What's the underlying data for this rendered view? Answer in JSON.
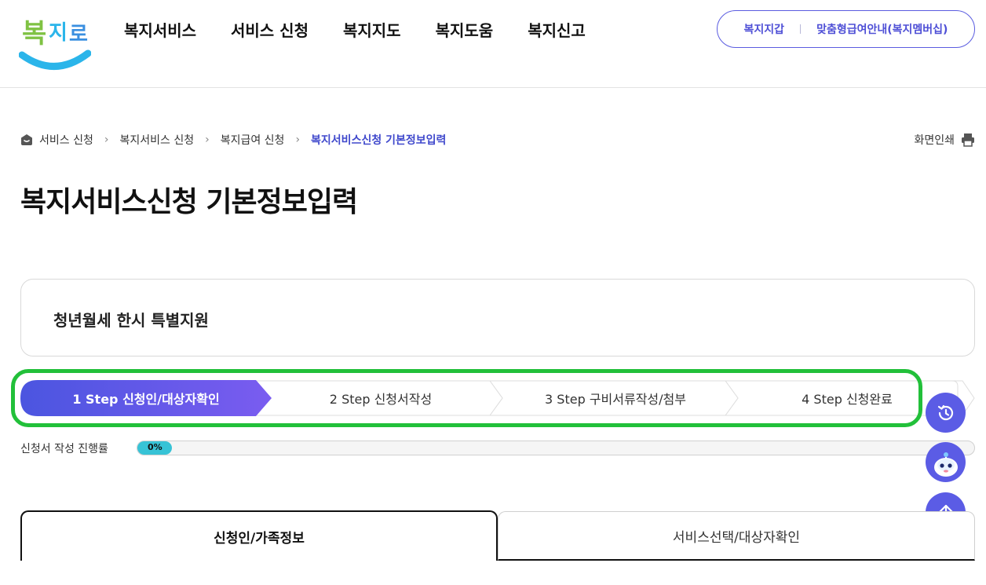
{
  "header": {
    "logo_text": "복지로",
    "nav": [
      "복지서비스",
      "서비스 신청",
      "복지지도",
      "복지도움",
      "복지신고"
    ],
    "util_links": [
      "복지지갑",
      "맞춤형급여안내(복지멤버십)"
    ]
  },
  "breadcrumb": [
    "서비스 신청",
    "복지서비스 신청",
    "복지급여 신청",
    "복지서비스신청 기본정보입력"
  ],
  "print_label": "화면인쇄",
  "page_title": "복지서비스신청 기본정보입력",
  "service_name": "청년월세 한시 특별지원",
  "steps": [
    {
      "label": "1 Step 신청인/대상자확인",
      "active": true
    },
    {
      "label": "2 Step 신청서작성",
      "active": false
    },
    {
      "label": "3 Step 구비서류작성/첨부",
      "active": false
    },
    {
      "label": "4 Step 신청완료",
      "active": false
    }
  ],
  "progress": {
    "label": "신청서 작성 진행률",
    "value_text": "0%",
    "value": 0
  },
  "tabs": [
    {
      "label": "신청인/가족정보",
      "active": true
    },
    {
      "label": "서비스선택/대상자확인",
      "active": false
    }
  ],
  "colors": {
    "accent": "#5b5ce5",
    "highlight": "#22c03a",
    "progress": "#37c3d6",
    "logo_blue": "#2bb5ea"
  }
}
